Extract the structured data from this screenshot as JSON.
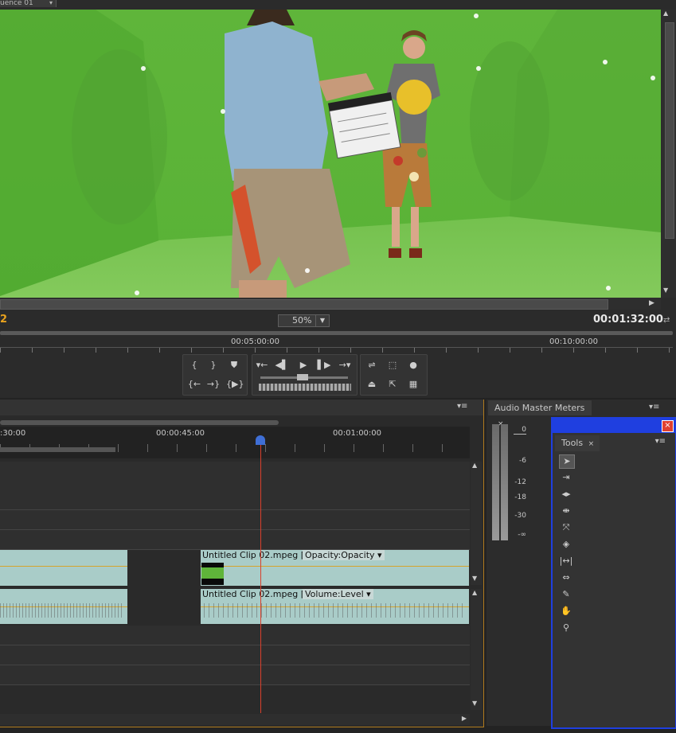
{
  "monitor": {
    "tab_label": "uence 01",
    "current_time": "2",
    "duration": "00:01:32:00",
    "zoom": "50%",
    "ruler": [
      "00:05:00:00",
      "00:10:00:00"
    ]
  },
  "timeline": {
    "ruler": [
      ":30:00",
      "00:00:45:00",
      "00:01:00:00"
    ],
    "video_clip": {
      "name": "Untitled Clip 02.mpeg [V]",
      "effect": "Opacity:Opacity"
    },
    "audio_clip": {
      "name": "Untitled Clip 02.mpeg [A]",
      "effect": "Volume:Level"
    }
  },
  "audio_meters": {
    "tab_label": "Audio Master Meters",
    "scale": [
      "0",
      "-6",
      "-12",
      "-18",
      "-30",
      "-∞"
    ]
  },
  "tools": {
    "tab_label": "Tools",
    "items": [
      "selection-tool",
      "track-select-tool",
      "ripple-edit-tool",
      "rolling-edit-tool",
      "rate-stretch-tool",
      "razor-tool",
      "slip-tool",
      "slide-tool",
      "pen-tool",
      "hand-tool",
      "zoom-tool"
    ]
  },
  "colors": {
    "accent": "#e8a21e",
    "tools_border": "#1f3fe0",
    "playhead": "#d9402c",
    "clip": "#a9ccc8"
  }
}
